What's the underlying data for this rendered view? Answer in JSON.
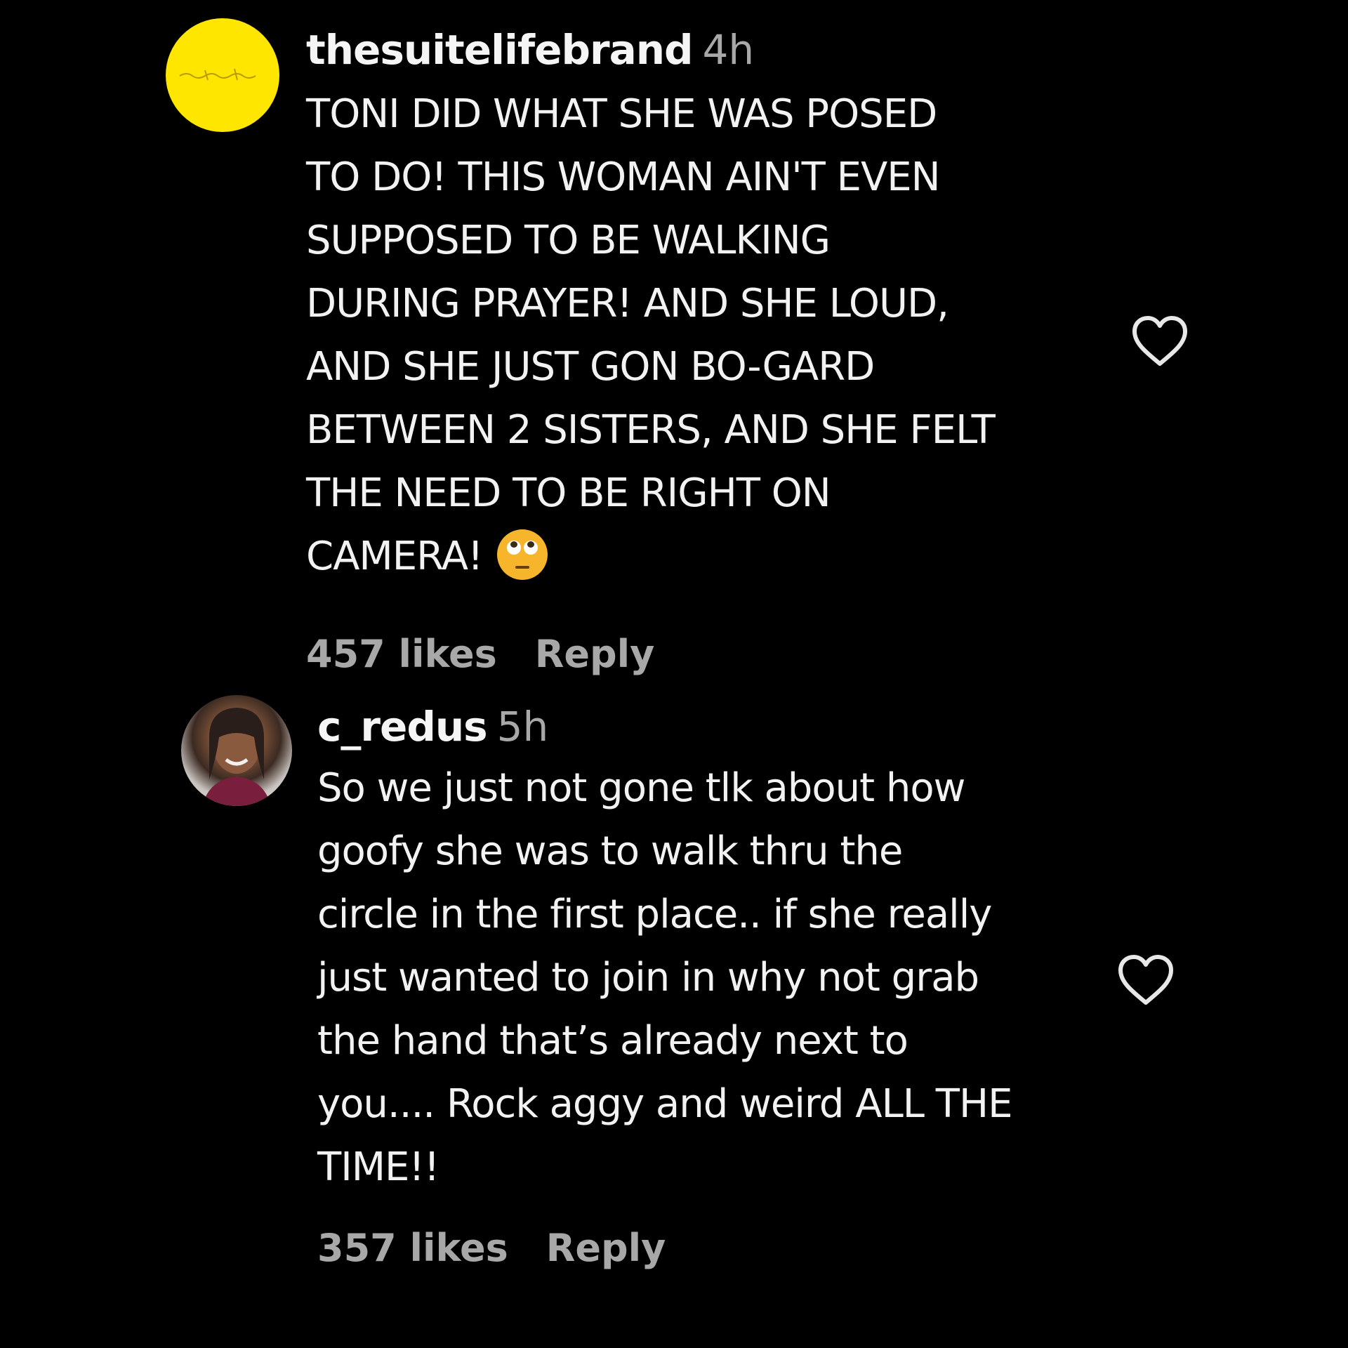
{
  "comments": [
    {
      "username": "thesuitelifebrand",
      "timestamp": "4h",
      "avatar_color": "#ffe600",
      "avatar_icon": "brand-logo-avatar",
      "lines": [
        "TONI DID WHAT SHE WAS POSED",
        "TO DO! THIS WOMAN AIN'T EVEN",
        "SUPPOSED TO BE WALKING",
        "DURING PRAYER! AND SHE LOUD,",
        "AND SHE JUST GON BO-GARD",
        "BETWEEN 2 SISTERS, AND SHE FELT",
        "THE NEED TO BE RIGHT ON",
        "CAMERA!"
      ],
      "trailing_emoji": "face-with-rolling-eyes-emoji",
      "likes": "457 likes",
      "reply_label": "Reply",
      "like_icon": "heart-outline-icon"
    },
    {
      "username": "c_redus",
      "timestamp": "5h",
      "avatar_icon": "user-photo-avatar",
      "lines": [
        "So we just not gone tlk about how",
        "goofy she was to walk thru the",
        "circle in the first place.. if she really",
        "just wanted to join in why not grab",
        "the hand that’s already next to",
        "you.... Rock aggy and weird ALL THE",
        "TIME!!"
      ],
      "likes": "357 likes",
      "reply_label": "Reply",
      "like_icon": "heart-outline-icon"
    }
  ],
  "colors": {
    "background": "#000000",
    "text_primary": "#f2f2f2",
    "text_secondary": "#a8a8a8",
    "brand_avatar": "#ffe600"
  }
}
